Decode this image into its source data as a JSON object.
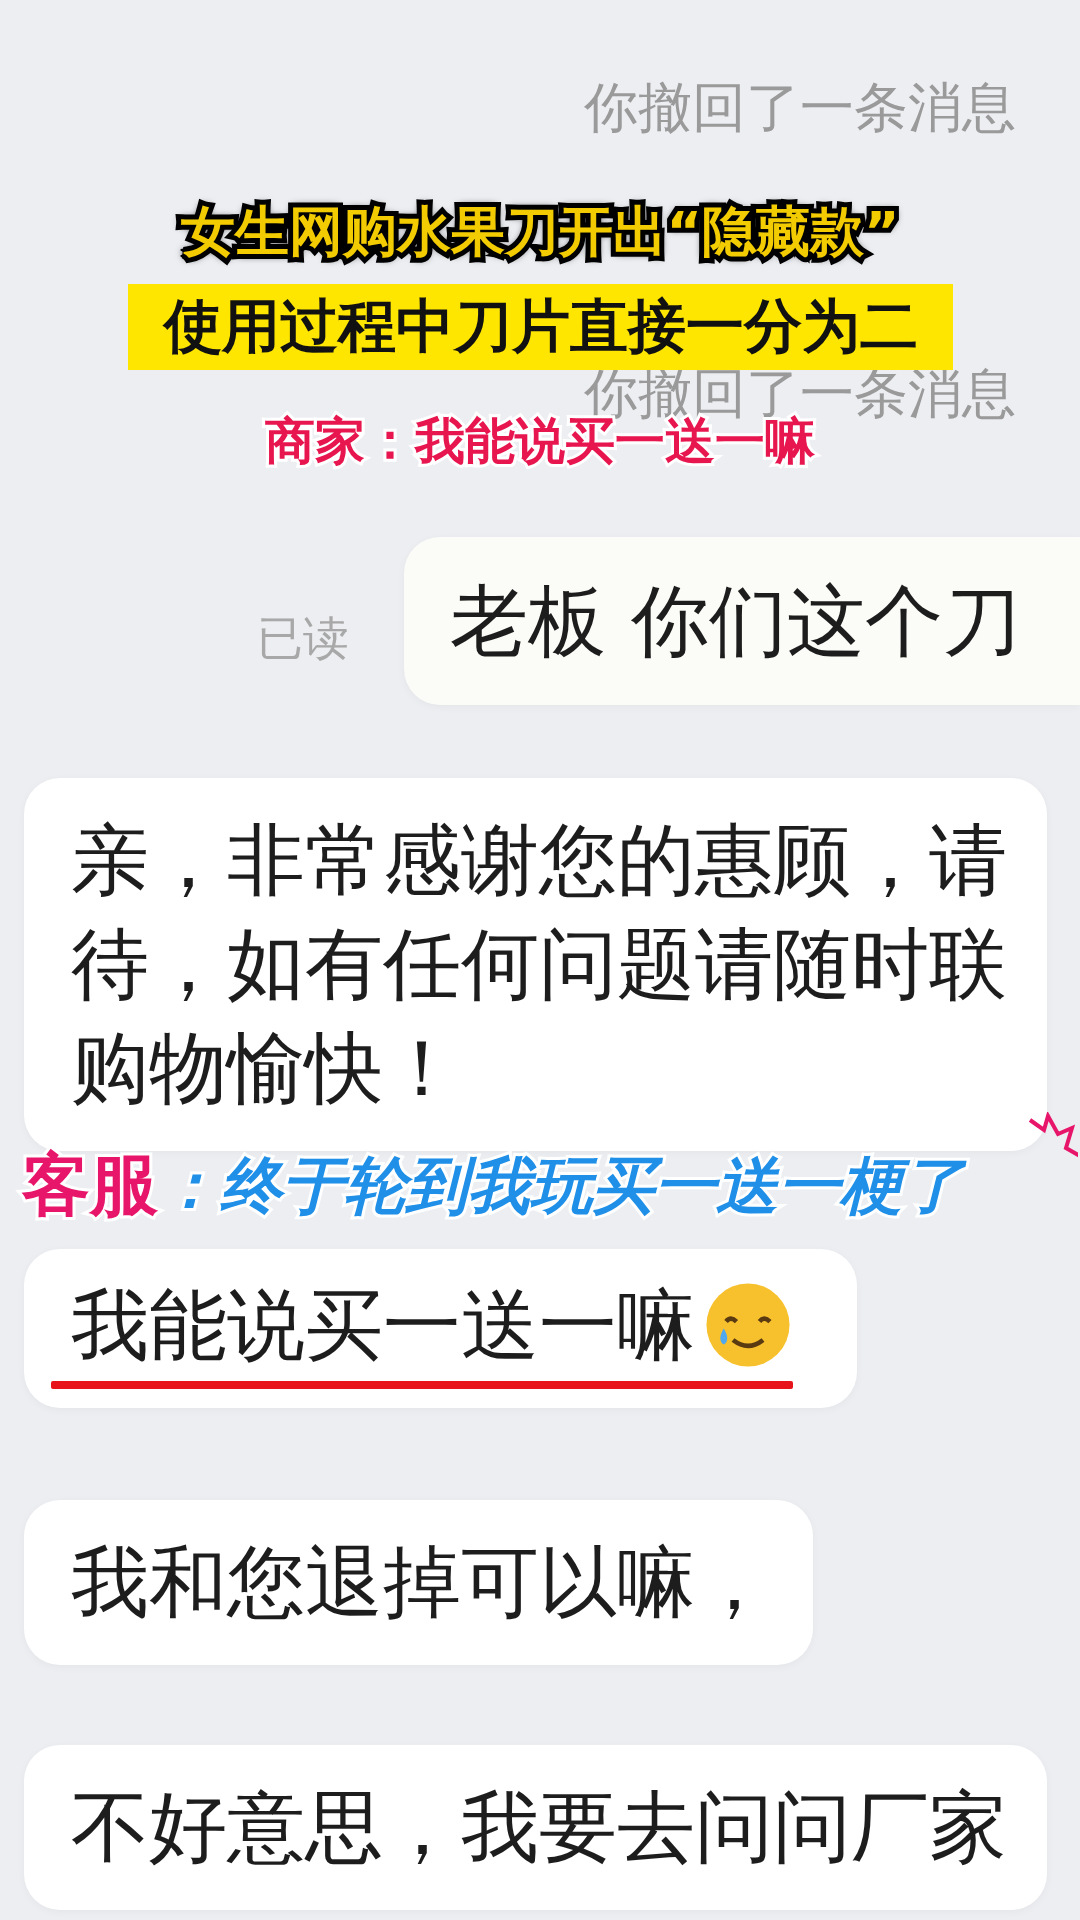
{
  "recalled_notices": [
    "你撤回了一条消息",
    "你撤回了一条消息"
  ],
  "captions": {
    "headline": "女生网购水果刀开出“隐藏款”",
    "subheadline": "使用过程中刀片直接一分为二",
    "merchant_quote": "商家：我能说买一送一嘛",
    "service_speaker": "客服",
    "service_comment": "：终于轮到我玩买一送一梗了"
  },
  "messages": [
    {
      "kind": "sent",
      "read_receipt": "已读",
      "lines": [
        "老板 你们这个刀"
      ]
    },
    {
      "kind": "received",
      "lines": [
        "亲，非常感谢您的惠顾，请",
        "待，如有任何问题请随时联",
        "购物愉快！"
      ]
    },
    {
      "kind": "received",
      "lines": [
        "我能说买一送一嘛"
      ],
      "emoji": true,
      "underlined": true
    },
    {
      "kind": "received",
      "lines": [
        "我和您退掉可以嘛，"
      ]
    },
    {
      "kind": "received",
      "lines": [
        "不好意思，我要去问问厂家"
      ]
    }
  ]
}
